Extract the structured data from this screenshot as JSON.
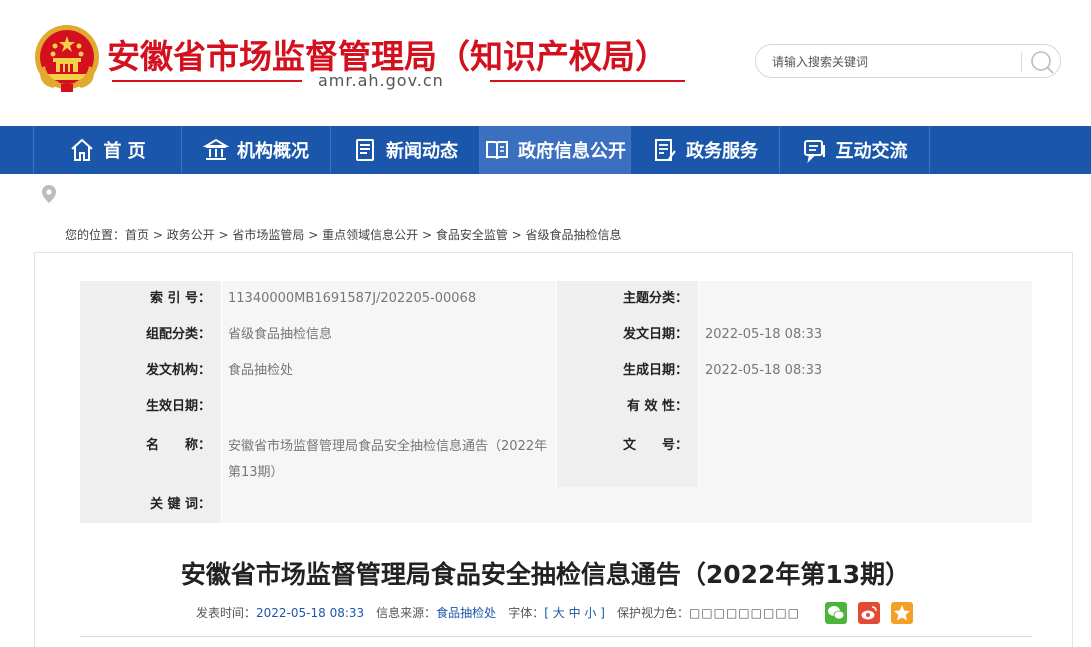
{
  "header": {
    "title": "安徽省市场监督管理局（知识产权局）",
    "domain": "amr.ah.gov.cn",
    "search": {
      "placeholder": "请输入搜索关键词"
    }
  },
  "nav": {
    "items": [
      {
        "label": "首 页",
        "icon": "home-icon"
      },
      {
        "label": "机构概况",
        "icon": "institution-icon"
      },
      {
        "label": "新闻动态",
        "icon": "news-icon"
      },
      {
        "label": "政府信息公开",
        "icon": "book-icon",
        "active": true
      },
      {
        "label": "政务服务",
        "icon": "form-icon"
      },
      {
        "label": "互动交流",
        "icon": "chat-icon"
      }
    ]
  },
  "breadcrumb": {
    "prefix": "您的位置：",
    "items": [
      "首页",
      "政务公开",
      "省市场监管局",
      "重点领域信息公开",
      "食品安全监管",
      "省级食品抽检信息"
    ],
    "separator": " > "
  },
  "meta": {
    "index_label": "索 引 号：",
    "index_value": "11340000MB1691587J/202205-00068",
    "topic_label": "主题分类：",
    "topic_value": "",
    "group_label": "组配分类：",
    "group_value": "省级食品抽检信息",
    "issue_date_label": "发文日期：",
    "issue_date_value": "2022-05-18 08:33",
    "agency_label": "发文机构：",
    "agency_value": "食品抽检处",
    "gen_date_label": "生成日期：",
    "gen_date_value": "2022-05-18 08:33",
    "effective_label": "生效日期：",
    "effective_value": "",
    "validity_label": "有 效 性：",
    "validity_value": "",
    "name_label": "名　　称：",
    "name_value": "安徽省市场监督管理局食品安全抽检信息通告（2022年第13期）",
    "docno_label": "文　　号：",
    "docno_value": "",
    "keywords_label": "关 键 词：",
    "keywords_value": ""
  },
  "article": {
    "title": "安徽省市场监督管理局食品安全抽检信息通告（2022年第13期）"
  },
  "pubinfo": {
    "time_label": "发表时间：",
    "time_value": "2022-05-18 08:33",
    "source_label": "信息来源：",
    "source_value": "食品抽检处",
    "font_label": "字体：",
    "font_open": "[",
    "font_large": "大",
    "font_medium": "中",
    "font_small": "小",
    "font_close": "]",
    "eye_label": "保护视力色：",
    "eye_swatches": "□□□□□□□□□"
  },
  "share": {
    "icons": [
      "wechat-icon",
      "weibo-icon",
      "qzone-icon"
    ]
  },
  "colors": {
    "brand_red": "#d5101e",
    "nav_blue": "#1a57aa",
    "nav_active": "#3a70bf"
  }
}
